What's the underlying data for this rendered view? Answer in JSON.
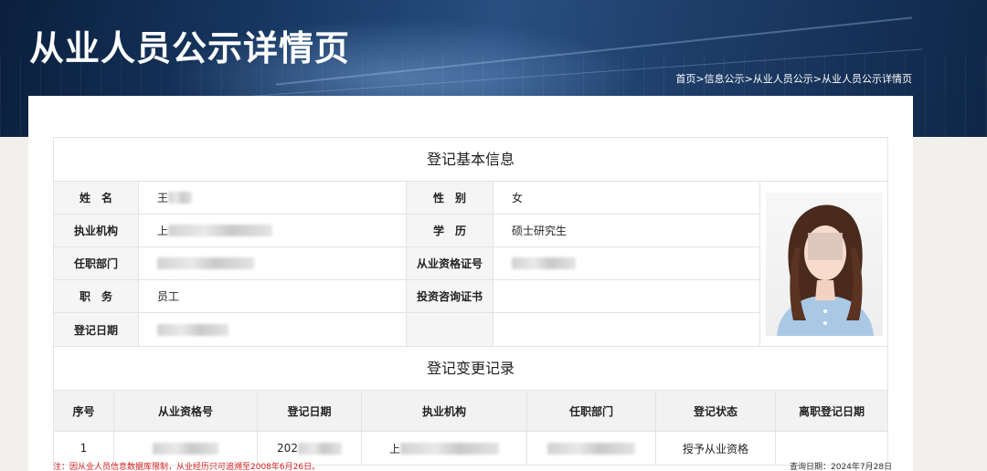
{
  "header": {
    "title": "从业人员公示详情页",
    "breadcrumb": [
      "首页",
      "信息公示",
      "从业人员公示",
      "从业人员公示详情页"
    ],
    "separator": ">"
  },
  "basic_info": {
    "section_title": "登记基本信息",
    "rows": [
      [
        {
          "label": "姓　名",
          "value": "王"
        },
        {
          "label": "性　别",
          "value": "女"
        }
      ],
      [
        {
          "label": "执业机构",
          "value": "上"
        },
        {
          "label": "学　历",
          "value": "硕士研究生"
        }
      ],
      [
        {
          "label": "任职部门",
          "value": ""
        },
        {
          "label": "从业资格证号",
          "value": ""
        }
      ],
      [
        {
          "label": "职　务",
          "value": "员工"
        },
        {
          "label": "投资咨询证书",
          "value": ""
        }
      ],
      [
        {
          "label": "登记日期",
          "value": ""
        },
        {
          "label": "",
          "value": ""
        }
      ]
    ]
  },
  "history": {
    "section_title": "登记变更记录",
    "columns": [
      "序号",
      "从业资格号",
      "登记日期",
      "执业机构",
      "任职部门",
      "登记状态",
      "离职登记日期"
    ],
    "rows": [
      [
        "1",
        "",
        "202",
        "上",
        "",
        "授予从业资格",
        ""
      ]
    ]
  },
  "footer": {
    "note": "注：因从业人员信息数据库限制，从业经历只可追溯至2008年6月26日。",
    "query_date": "查询日期：2024年7月28日"
  },
  "colors": {
    "banner": "#183a66",
    "note": "#d21f1f",
    "label_bg": "#f5f5f5"
  }
}
